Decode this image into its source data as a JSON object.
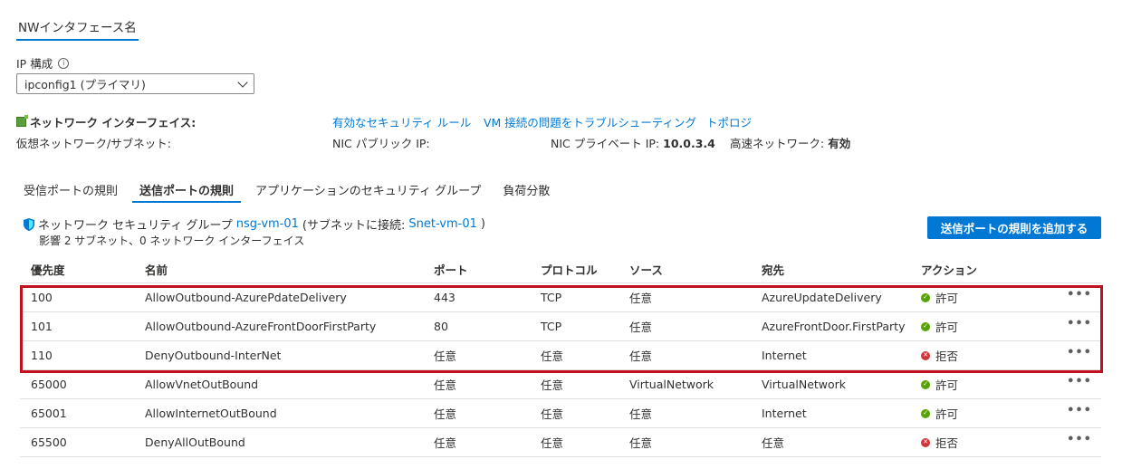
{
  "nic_tab": "NWインタフェース名",
  "ip_config": {
    "label": "IP 構成",
    "info_icon": "info-icon",
    "selected": "ipconfig1 (プライマリ)"
  },
  "nic": {
    "title": "ネットワーク インターフェイス:",
    "links": [
      "有効なセキュリティ ルール",
      "VM 接続の問題をトラブルシューティング",
      "トポロジ"
    ],
    "vnet_label": "仮想ネットワーク/サブネット:",
    "public_ip_label": "NIC パブリック IP:",
    "private_ip_label": "NIC プライベート IP:",
    "private_ip_value": "10.0.3.4",
    "accel_label": "高速ネットワーク:",
    "accel_value": "有効"
  },
  "tabs": [
    {
      "label": "受信ポートの規則",
      "active": false
    },
    {
      "label": "送信ポートの規則",
      "active": true
    },
    {
      "label": "アプリケーションのセキュリティ グループ",
      "active": false
    },
    {
      "label": "負荷分散",
      "active": false
    }
  ],
  "nsg": {
    "prefix": "ネットワーク セキュリティ グループ",
    "name": "nsg-vm-01",
    "subnet_prefix": "(サブネットに接続:",
    "subnet_name": "Snet-vm-01",
    "subnet_suffix": ")",
    "impact": "影響 2 サブネット、0 ネットワーク インターフェイス"
  },
  "add_button": "送信ポートの規則を追加する",
  "table": {
    "headers": [
      "優先度",
      "名前",
      "ポート",
      "プロトコル",
      "ソース",
      "宛先",
      "アクション"
    ],
    "rows": [
      {
        "priority": "100",
        "name": "AllowOutbound-AzurePdateDelivery",
        "port": "443",
        "protocol": "TCP",
        "source": "任意",
        "dest": "AzureUpdateDelivery",
        "action": "許可",
        "allow": true
      },
      {
        "priority": "101",
        "name": "AllowOutbound-AzureFrontDoorFirstParty",
        "port": "80",
        "protocol": "TCP",
        "source": "任意",
        "dest": "AzureFrontDoor.FirstParty",
        "action": "許可",
        "allow": true
      },
      {
        "priority": "110",
        "name": "DenyOutbound-InterNet",
        "port": "任意",
        "protocol": "任意",
        "source": "任意",
        "dest": "Internet",
        "action": "拒否",
        "allow": false
      },
      {
        "priority": "65000",
        "name": "AllowVnetOutBound",
        "port": "任意",
        "protocol": "任意",
        "source": "VirtualNetwork",
        "dest": "VirtualNetwork",
        "action": "許可",
        "allow": true
      },
      {
        "priority": "65001",
        "name": "AllowInternetOutBound",
        "port": "任意",
        "protocol": "任意",
        "source": "任意",
        "dest": "Internet",
        "action": "許可",
        "allow": true
      },
      {
        "priority": "65500",
        "name": "DenyAllOutBound",
        "port": "任意",
        "protocol": "任意",
        "source": "任意",
        "dest": "任意",
        "action": "拒否",
        "allow": false
      }
    ],
    "more_label": "•••"
  },
  "colors": {
    "accent": "#0078d4",
    "allow": "#57a300",
    "deny": "#d13438",
    "highlight": "#c00f1f"
  }
}
